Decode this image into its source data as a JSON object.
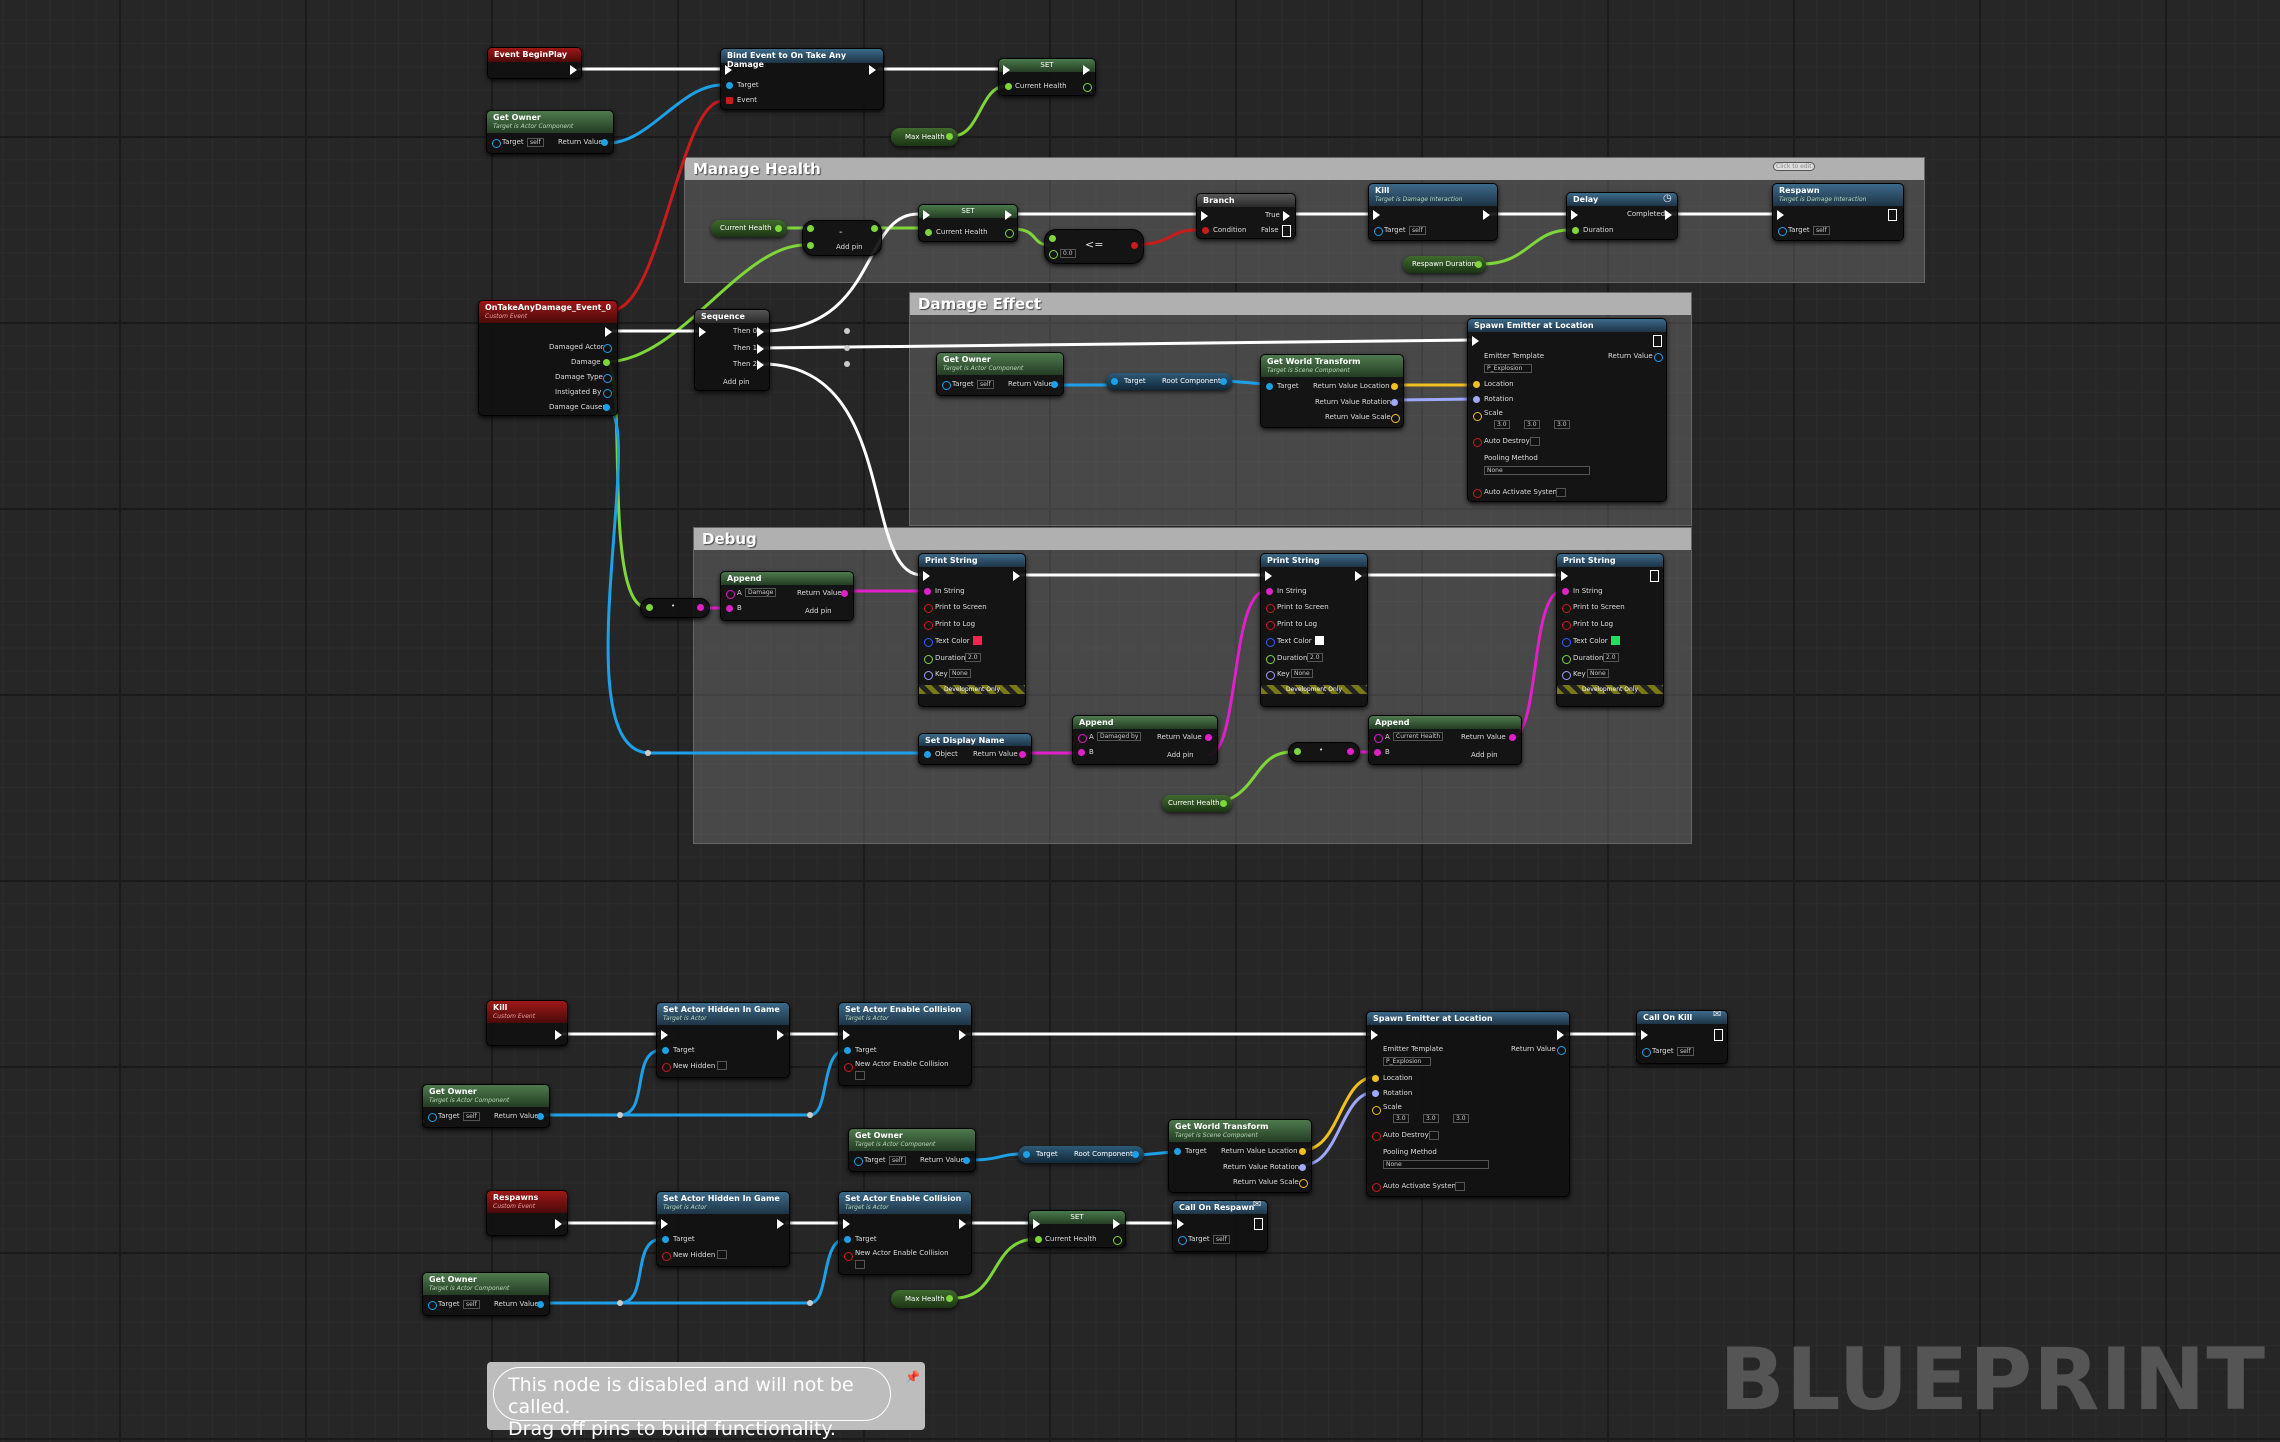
{
  "comments": {
    "manage_health": "Manage Health",
    "damage_effect": "Damage Effect",
    "debug": "Debug",
    "click_to_edit": "Click to edit"
  },
  "nodes": {
    "event_begin_play": "Event BeginPlay",
    "bind_event": "Bind Event to On Take Any Damage",
    "set": "SET",
    "get_owner": "Get Owner",
    "target_is_actor_component": "Target is Actor Component",
    "on_take_any_damage": "OnTakeAnyDamage_Event_0",
    "custom_event": "Custom Event",
    "sequence": "Sequence",
    "branch": "Branch",
    "kill": "Kill",
    "target_is_damage_interaction": "Target is Damage Interaction",
    "delay": "Delay",
    "respawn": "Respawn",
    "get_world_transform": "Get World Transform",
    "target_is_scene_component": "Target is Scene Component",
    "spawn_emitter": "Spawn Emitter at Location",
    "print_string": "Print String",
    "append": "Append",
    "set_display_name": "Set Display Name",
    "set_actor_hidden": "Set Actor Hidden In Game",
    "set_actor_collision": "Set Actor Enable Collision",
    "target_is_actor": "Target is Actor",
    "call_on_kill": "Call On Kill",
    "call_on_respawn": "Call On Respawn",
    "respawns": "Respawns"
  },
  "pins": {
    "target": "Target",
    "event": "Event",
    "current_health": "Current Health",
    "max_health": "Max Health",
    "return_value": "Return Value",
    "self": "self",
    "damaged_actor": "Damaged Actor",
    "damage": "Damage",
    "damage_type": "Damage Type",
    "instigated_by": "Instigated By",
    "damage_causer": "Damage Causer",
    "then0": "Then 0",
    "then1": "Then 1",
    "then2": "Then 2",
    "add_pin": "Add pin",
    "minus": "-",
    "lte": "<=",
    "zero": "0.0",
    "true": "True",
    "false": "False",
    "condition": "Condition",
    "completed": "Completed",
    "duration": "Duration",
    "respawn_duration": "Respawn Duration",
    "root_component": "Root Component",
    "rv_location": "Return Value Location",
    "rv_rotation": "Return Value Rotation",
    "rv_scale": "Return Value Scale",
    "emitter_template": "Emitter Template",
    "p_explosion": "P_Explosion",
    "location": "Location",
    "rotation": "Rotation",
    "scale": "Scale",
    "three": "3.0",
    "x": "X",
    "y": "Y",
    "z": "Z",
    "auto_destroy": "Auto Destroy",
    "pooling_method": "Pooling Method",
    "none": "None",
    "auto_activate": "Auto Activate System",
    "in_string": "In String",
    "print_to_screen": "Print to Screen",
    "print_to_log": "Print to Log",
    "text_color": "Text Color",
    "key": "Key",
    "two": "2.0",
    "development_only": "Development Only",
    "a": "A",
    "b": "B",
    "damage_str": "Damage",
    "damaged_by": "Damaged by",
    "current_health_str": "Current Health",
    "object": "Object",
    "new_hidden": "New Hidden",
    "new_actor_collision": "New Actor Enable Collision",
    "star": "*",
    "conv": "•"
  },
  "tooltip": {
    "line1": "This node is disabled and will not be called.",
    "line2": "Drag off pins to build functionality."
  },
  "watermark": "BLUEPRINT",
  "colors": {
    "exec": "#ffffff",
    "object": "#1ea0e6",
    "float": "#7fd63a",
    "string": "#e020c8",
    "vector": "#f0c020",
    "rotator": "#9fa8ff",
    "red": "#c81c1c",
    "text_red": "#ff2050",
    "text_white": "#ffffff",
    "text_green": "#20e060"
  }
}
